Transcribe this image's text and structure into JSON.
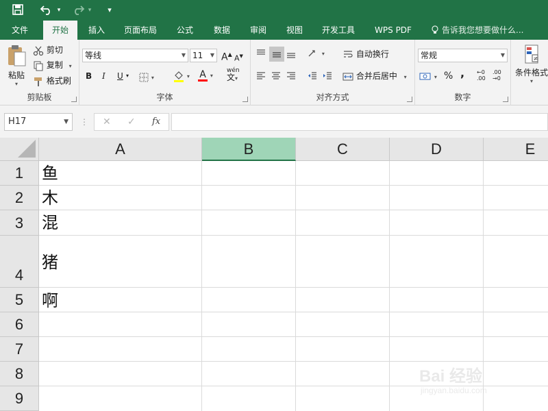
{
  "quick_access": {
    "save_icon": "save-icon",
    "undo_icon": "undo-icon",
    "redo_icon": "redo-icon",
    "customize_glyph": "▾"
  },
  "tabs": [
    {
      "label": "文件",
      "active": false
    },
    {
      "label": "开始",
      "active": true
    },
    {
      "label": "插入",
      "active": false
    },
    {
      "label": "页面布局",
      "active": false
    },
    {
      "label": "公式",
      "active": false
    },
    {
      "label": "数据",
      "active": false
    },
    {
      "label": "审阅",
      "active": false
    },
    {
      "label": "视图",
      "active": false
    },
    {
      "label": "开发工具",
      "active": false
    },
    {
      "label": "WPS PDF",
      "active": false
    }
  ],
  "tell_me": "告诉我您想要做什么...",
  "ribbon": {
    "clipboard": {
      "label": "剪贴板",
      "paste": "粘贴",
      "cut": "剪切",
      "copy": "复制",
      "format_painter": "格式刷"
    },
    "font": {
      "label": "字体",
      "font_name": "等线",
      "font_size": "11",
      "bold": "B",
      "italic": "I",
      "underline": "U",
      "grow": "A",
      "shrink": "A",
      "phonetic": "wén"
    },
    "alignment": {
      "label": "对齐方式",
      "wrap_text": "自动换行",
      "merge_center": "合并后居中"
    },
    "number": {
      "label": "数字",
      "format": "常规",
      "percent": "%",
      "comma": ","
    },
    "styles": {
      "conditional_formatting": "条件格式"
    }
  },
  "formula_bar": {
    "name_box": "H17",
    "dots": "⋮",
    "cancel": "✕",
    "enter": "✓",
    "fx": "fx",
    "value": ""
  },
  "sheet": {
    "columns": [
      "A",
      "B",
      "C",
      "D",
      "E"
    ],
    "selected_column": "B",
    "rows": [
      "1",
      "2",
      "3",
      "4",
      "5",
      "6",
      "7",
      "8",
      "9"
    ],
    "cells_col_a": [
      "鱼",
      "木",
      "混",
      "猪",
      "啊",
      "",
      "",
      "",
      ""
    ]
  },
  "watermark": {
    "line1": "Bai 经验",
    "line2": "jingyan.baidu.com"
  },
  "colors": {
    "excel_green": "#217346",
    "selected_header": "#9fd5b7",
    "ribbon_bg": "#f3f3f3"
  }
}
